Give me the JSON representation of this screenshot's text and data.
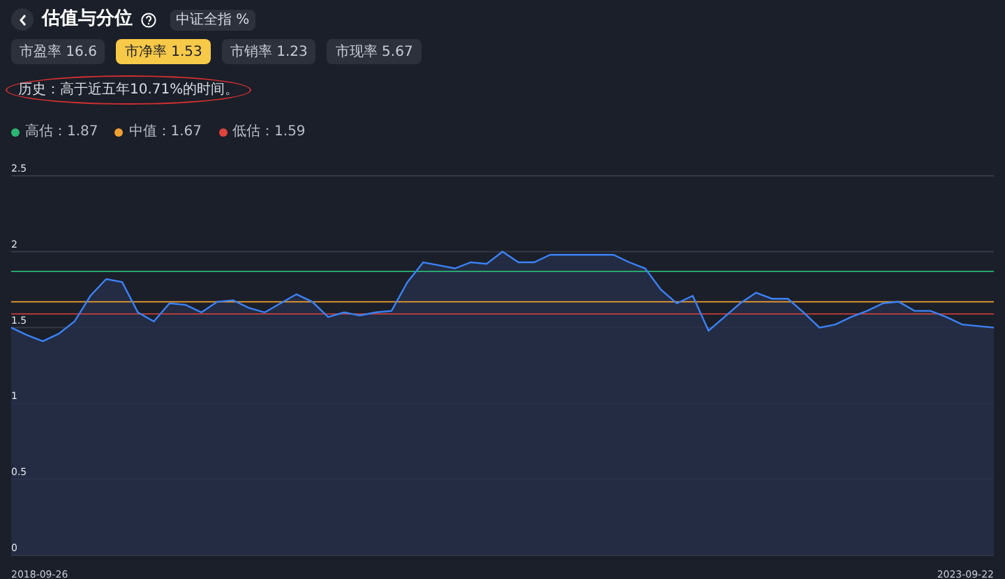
{
  "header": {
    "title": "估值与分位",
    "badge": "中证全指 %"
  },
  "tabs": [
    {
      "label": "市盈率 16.6",
      "selected": false
    },
    {
      "label": "市净率 1.53",
      "selected": true
    },
    {
      "label": "市销率 1.23",
      "selected": false
    },
    {
      "label": "市现率 5.67",
      "selected": false
    }
  ],
  "history": {
    "text": "历史：高于近五年10.71%的时间。",
    "circled": true
  },
  "chart": {
    "chart_data": {
      "type": "area",
      "ylim": [
        0,
        2.5
      ],
      "yticks": [
        {
          "value": 0,
          "label": "0"
        },
        {
          "value": 0.5,
          "label": "0.5"
        },
        {
          "value": 1,
          "label": "1"
        },
        {
          "value": 1.5,
          "label": "1.5"
        },
        {
          "value": 2,
          "label": "2"
        },
        {
          "value": 2.5,
          "label": "2.5"
        }
      ],
      "grid": true,
      "series": [
        {
          "color": "#3b82f6",
          "values": [
            1.5,
            1.45,
            1.41,
            1.46,
            1.54,
            1.71,
            1.82,
            1.8,
            1.6,
            1.54,
            1.66,
            1.65,
            1.6,
            1.67,
            1.68,
            1.63,
            1.6,
            1.66,
            1.72,
            1.67,
            1.57,
            1.6,
            1.58,
            1.6,
            1.61,
            1.8,
            1.93,
            1.91,
            1.89,
            1.93,
            1.92,
            2.0,
            1.93,
            1.93,
            1.98,
            1.98,
            1.98,
            1.98,
            1.98,
            1.93,
            1.89,
            1.75,
            1.66,
            1.71,
            1.48,
            1.57,
            1.66,
            1.73,
            1.69,
            1.69,
            1.6,
            1.5,
            1.52,
            1.57,
            1.61,
            1.66,
            1.67,
            1.61,
            1.61,
            1.57,
            1.52,
            1.51,
            1.5
          ]
        }
      ],
      "ref_lines": [
        {
          "axis": "y",
          "value": 1.87,
          "color": "#2bb673",
          "label": "高估：1.87"
        },
        {
          "axis": "y",
          "value": 1.67,
          "color": "#f0a030",
          "label": "中值：1.67"
        },
        {
          "axis": "y",
          "value": 1.59,
          "color": "#e0443c",
          "label": "低估：1.59"
        }
      ]
    },
    "start_date": "2018-09-26",
    "end_date": "2023-09-22"
  }
}
